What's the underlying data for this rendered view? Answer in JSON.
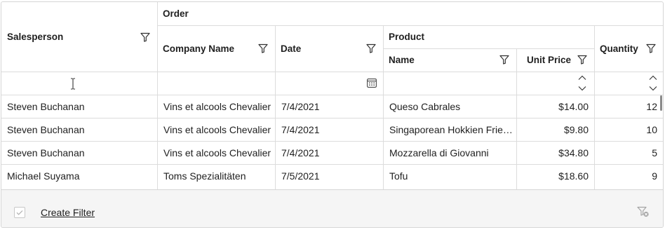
{
  "headers": {
    "salesperson": "Salesperson",
    "order": "Order",
    "company_name": "Company Name",
    "date": "Date",
    "product": "Product",
    "name": "Name",
    "unit_price": "Unit Price",
    "quantity": "Quantity"
  },
  "rows": [
    {
      "salesperson": "Steven Buchanan",
      "company": "Vins et alcools Chevalier",
      "date": "7/4/2021",
      "name": "Queso Cabrales",
      "price": "$14.00",
      "qty": "12"
    },
    {
      "salesperson": "Steven Buchanan",
      "company": "Vins et alcools Chevalier",
      "date": "7/4/2021",
      "name": "Singaporean Hokkien Frie…",
      "price": "$9.80",
      "qty": "10"
    },
    {
      "salesperson": "Steven Buchanan",
      "company": "Vins et alcools Chevalier",
      "date": "7/4/2021",
      "name": "Mozzarella di Giovanni",
      "price": "$34.80",
      "qty": "5"
    },
    {
      "salesperson": "Michael Suyama",
      "company": "Toms Spezialitäten",
      "date": "7/5/2021",
      "name": "Tofu",
      "price": "$18.60",
      "qty": "9"
    }
  ],
  "footer": {
    "create_filter_label": "Create Filter"
  },
  "colors": {
    "border": "#dcdcdc",
    "footer_bg": "#f5f5f5",
    "text": "#1f1f1f"
  }
}
